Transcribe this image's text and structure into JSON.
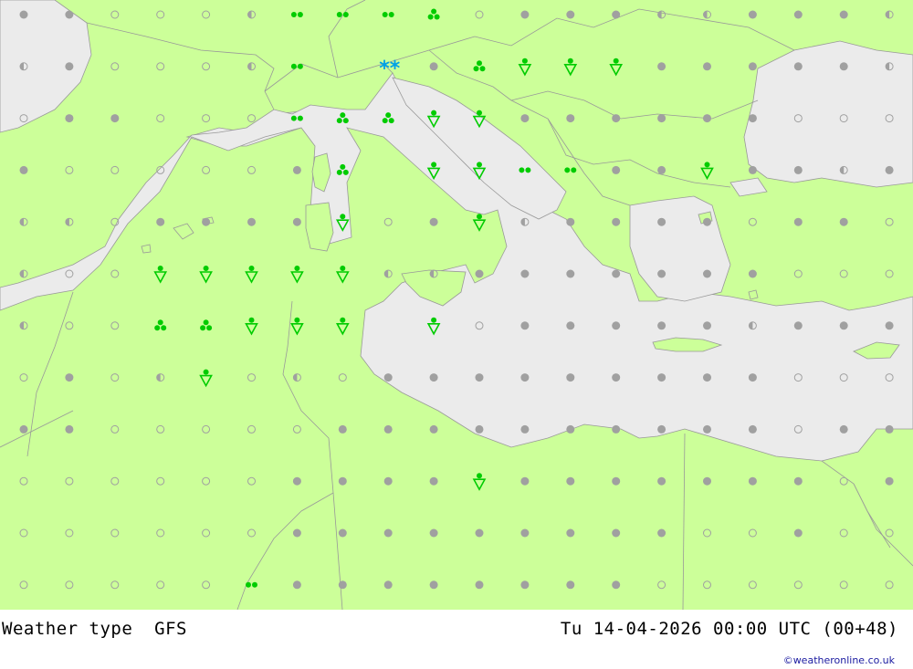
{
  "title": "Weather type",
  "model": "GFS",
  "datetime": "Tu 14-04-2026 00:00 UTC (00+48)",
  "credit": "©weatheronline.co.uk",
  "colors": {
    "land": "#ccff99",
    "sea": "#ebebeb",
    "border": "#a0a0a0",
    "symbol_gray": "#a0a0a0",
    "rain_green": "#00cc00",
    "snow_blue": "#00a0e6"
  },
  "legend_symbols": {
    "c": "clear / small circle",
    "p": "partly cloudy / half-filled circle",
    "o": "overcast / filled grey circle",
    "t": "two drops (rain)",
    "h": "three drops (heavy rain)",
    "s": "rain shower",
    "d": "drizzle",
    "k": "snow"
  },
  "symbol_rows": [
    "oocccpttthcoooppooop",
    "pocccpt.kohsssooooop",
    "coocccthhssooooooccc",
    "occcccoh.ssttoosoopoc",
    "ppcooooscospoooocoocp",
    "pccsssssppooooooocccp",
    "pcchhsss.scooooopoooo",
    "cocpscpcoooooooooccc",
    "oocccccoooooooooocoo",
    "ccccccoooosooooooocoo",
    "ccccccoooooooooccocc",
    "ccccctooooooooccccccc"
  ]
}
